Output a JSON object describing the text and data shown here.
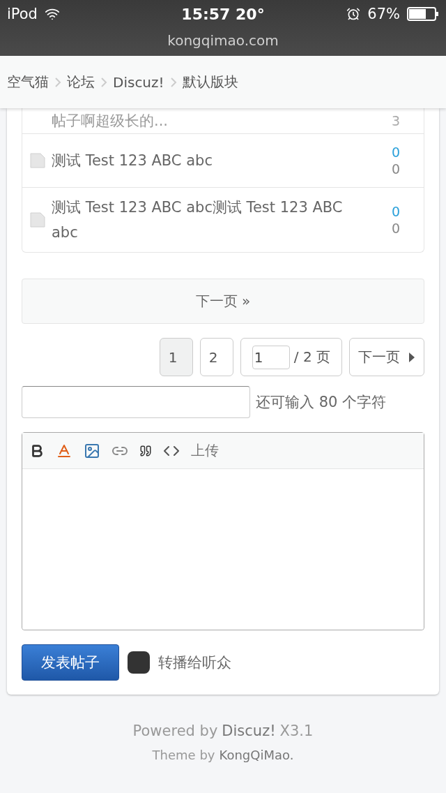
{
  "status_bar": {
    "carrier": "iPod",
    "time": "15:57 20°",
    "battery": "67%"
  },
  "address_bar": {
    "url": "kongqimao.com"
  },
  "breadcrumb": [
    "空气猫",
    "论坛",
    "Discuz!",
    "默认版块"
  ],
  "threads": [
    {
      "kind": "clipped",
      "title": "帖子啊超级长的...",
      "views": "3"
    },
    {
      "kind": "full",
      "title": "测试 Test 123 ABC abc",
      "replies": "0",
      "views": "0"
    },
    {
      "kind": "full",
      "title": "测试 Test 123 ABC abc测试 Test 123 ABC abc",
      "replies": "0",
      "views": "0"
    }
  ],
  "load_more": "下一页 »",
  "pagination": {
    "pages": [
      {
        "label": "1",
        "selected": true
      },
      {
        "label": "2",
        "selected": false
      }
    ],
    "jump_value": "1",
    "total": "/ 2 页",
    "next": "下一页"
  },
  "title_field": {
    "hint": "还可输入 80 个字符"
  },
  "editor": {
    "upload": "上传"
  },
  "submit": {
    "label": "发表帖子",
    "broadcast": {
      "label": "转播给听众",
      "checked": false
    }
  },
  "footer": {
    "powered_prefix": "Powered by",
    "powered_link": "Discuz!",
    "version": "X3.1",
    "theme_prefix": "Theme by",
    "theme_link": "KongQiMao."
  }
}
